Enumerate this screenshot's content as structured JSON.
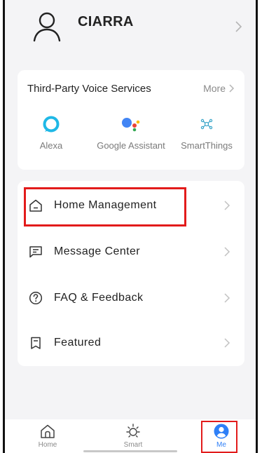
{
  "profile": {
    "username": "CIARRA",
    "icon": "user-icon"
  },
  "voice_services": {
    "title": "Third-Party Voice Services",
    "more_label": "More",
    "items": [
      {
        "label": "Alexa",
        "icon": "alexa-icon"
      },
      {
        "label": "Google Assistant",
        "icon": "google-assistant-icon"
      },
      {
        "label": "SmartThings",
        "icon": "smartthings-icon"
      }
    ]
  },
  "menu": {
    "items": [
      {
        "label": "Home Management",
        "icon": "house-icon"
      },
      {
        "label": "Message Center",
        "icon": "message-icon"
      },
      {
        "label": "FAQ & Feedback",
        "icon": "question-icon"
      },
      {
        "label": "Featured",
        "icon": "bookmark-icon"
      }
    ]
  },
  "tabbar": {
    "items": [
      {
        "label": "Home",
        "icon": "house-icon"
      },
      {
        "label": "Smart",
        "icon": "sun-icon"
      },
      {
        "label": "Me",
        "icon": "user-icon"
      }
    ]
  },
  "colors": {
    "accent": "#2e7ff7",
    "highlight": "#e21b1b",
    "alexa": "#1fb8e6"
  }
}
